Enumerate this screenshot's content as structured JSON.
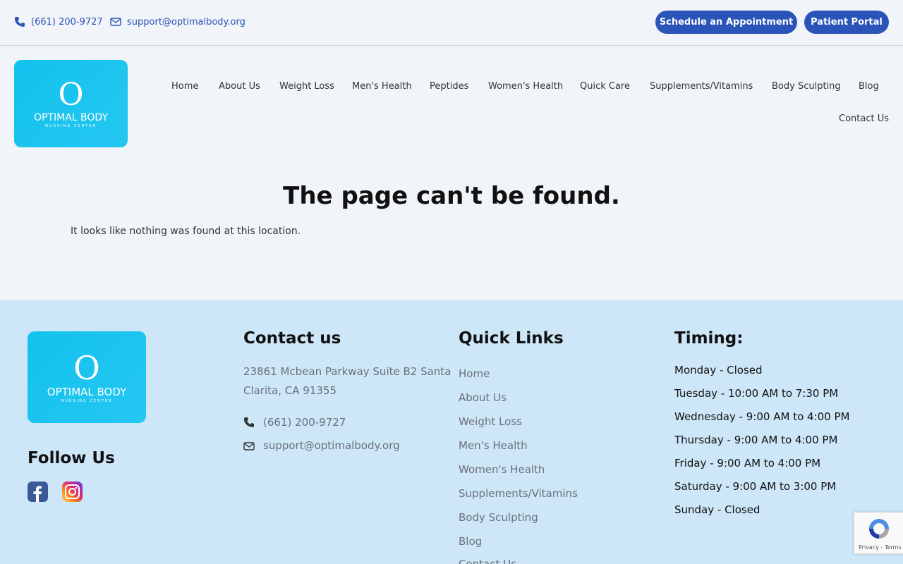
{
  "topbar": {
    "phone": "(661) 200-9727",
    "email": "support@optimalbody.org",
    "schedule_button": "Schedule an Appointment",
    "portal_button": "Patient Portal",
    "accent": "#2a54b7"
  },
  "logo": {
    "mark": "O",
    "name": "OPTIMAL BODY",
    "sub": "NURSING CENTER"
  },
  "nav": {
    "items": [
      "Home",
      "About Us",
      "Weight Loss",
      "Men's Health",
      "Peptides",
      "Women's Health",
      "Quick Care",
      "Supplements/Vitamins",
      "Body Sculpting",
      "Blog",
      "Contact Us"
    ]
  },
  "main": {
    "title": "The page can't be found.",
    "message": "It looks like nothing was found at this location."
  },
  "footer": {
    "follow_heading": "Follow Us",
    "contact": {
      "heading": "Contact us",
      "address_line1": "23861 Mcbean Parkway Suite B2 Santa",
      "address_line2": "Clarita, CA 91355",
      "phone": "(661) 200-9727",
      "email": "support@optimalbody.org"
    },
    "quick_links": {
      "heading": "Quick Links",
      "items": [
        "Home",
        "About Us",
        "Weight Loss",
        "Men's Health",
        "Women's Health",
        "Supplements/Vitamins",
        "Body Sculpting",
        "Blog",
        "Contact Us"
      ]
    },
    "timing": {
      "heading": "Timing:",
      "items": [
        "Monday - Closed",
        "Tuesday - 10:00 AM to 7:30 PM",
        "Wednesday - 9:00 AM to 4:00 PM",
        "Thursday - 9:00 AM to 4:00 PM",
        "Friday - 9:00 AM to 4:00 PM",
        "Saturday - 9:00 AM to 3:00 PM",
        "Sunday - Closed"
      ]
    }
  },
  "recaptcha": {
    "text": "Privacy - Terms"
  }
}
